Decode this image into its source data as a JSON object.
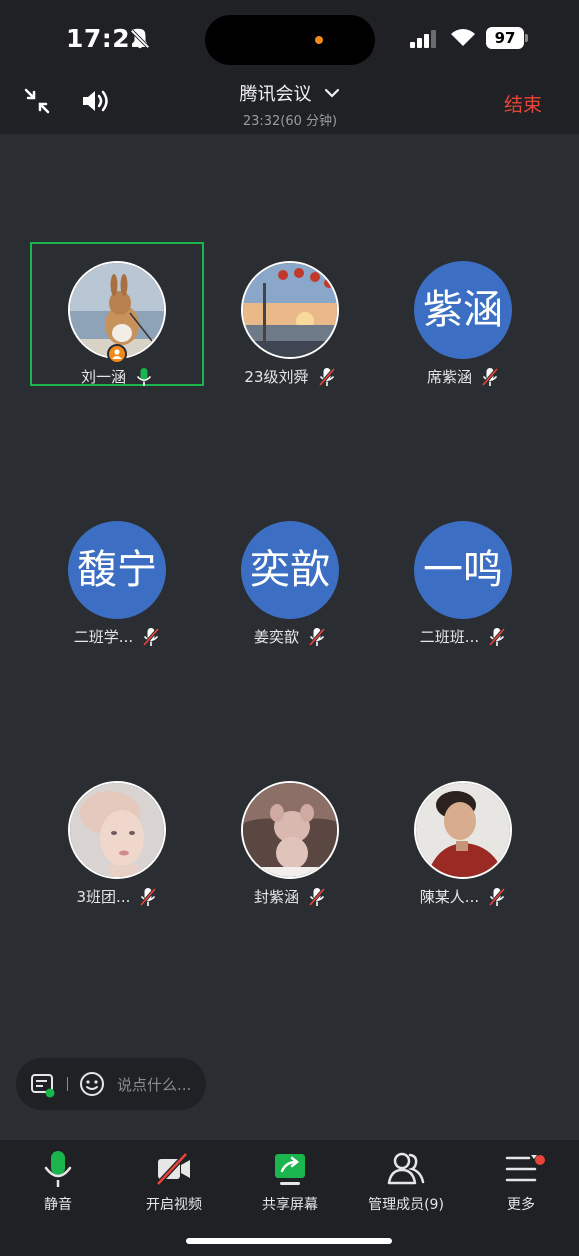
{
  "status_bar": {
    "time": "17:22",
    "battery": "97"
  },
  "header": {
    "title": "腾讯会议",
    "subtitle": "23:32(60 分钟)",
    "end_label": "结束"
  },
  "participants": [
    {
      "name": "刘一涵",
      "avatar": "photo-rabbit",
      "mic": "on",
      "active": true,
      "host": true
    },
    {
      "name": "23级刘舜",
      "avatar": "photo-sunset",
      "mic": "muted"
    },
    {
      "name": "席紫涵",
      "avatar_text": "紫涵",
      "mic": "muted"
    },
    {
      "name": "二班学...",
      "avatar_text": "馥宁",
      "mic": "muted"
    },
    {
      "name": "姜奕歆",
      "avatar_text": "奕歆",
      "mic": "muted"
    },
    {
      "name": "二班班...",
      "avatar_text": "一鸣",
      "mic": "muted"
    },
    {
      "name": "3班团...",
      "avatar": "photo-portrait",
      "mic": "muted"
    },
    {
      "name": "封紫涵",
      "avatar": "photo-toy",
      "mic": "muted"
    },
    {
      "name": "陳某人...",
      "avatar": "photo-boy",
      "mic": "muted"
    }
  ],
  "chat": {
    "placeholder": "说点什么..."
  },
  "toolbar": {
    "mute_label": "静音",
    "video_label": "开启视频",
    "share_label": "共享屏幕",
    "members_label": "管理成员(9)",
    "more_label": "更多"
  },
  "colors": {
    "accent_green": "#1ab54c",
    "end_red": "#e8443a",
    "avatar_blue": "#3c6fc3",
    "host_orange": "#f08a1c"
  }
}
